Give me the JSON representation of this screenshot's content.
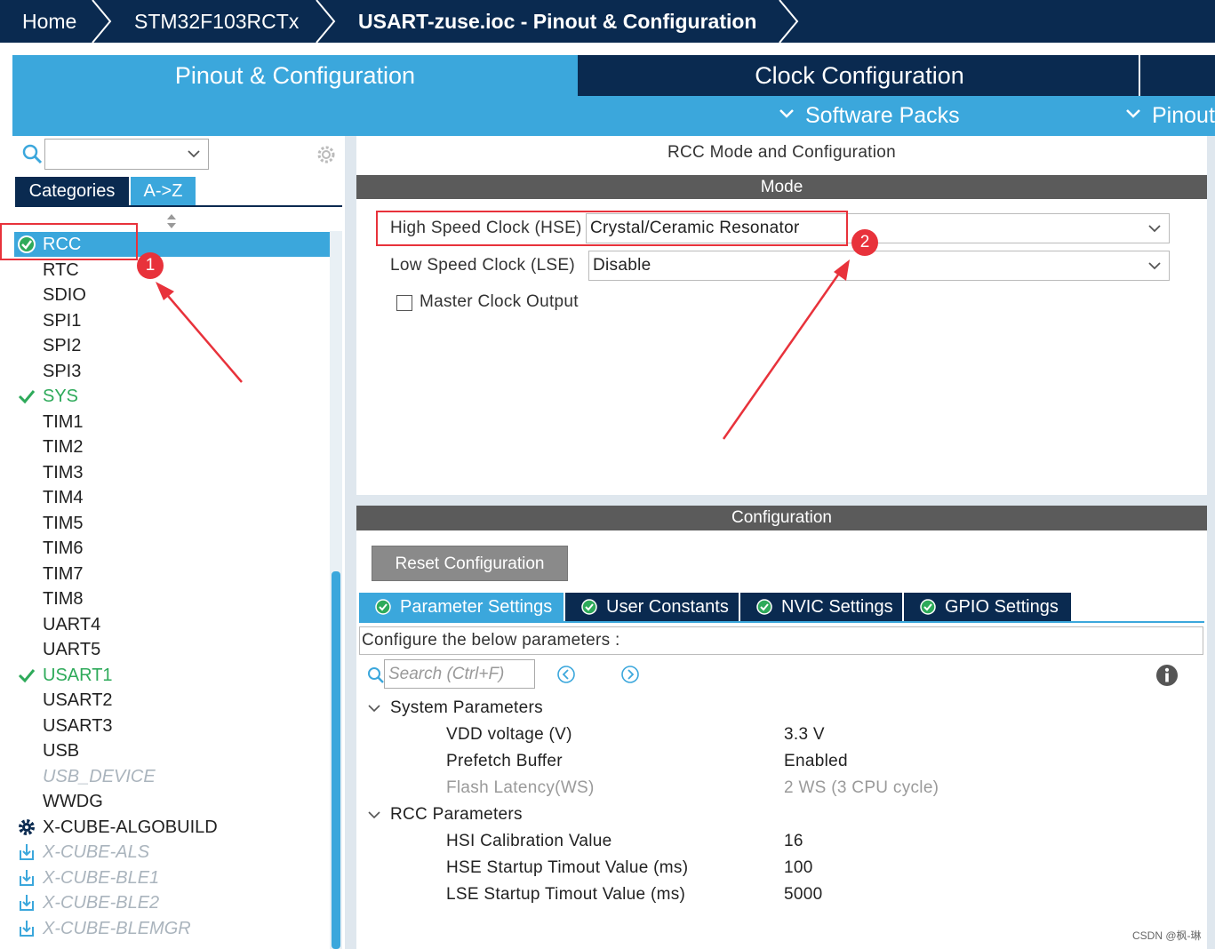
{
  "breadcrumb": {
    "home": "Home",
    "device": "STM32F103RCTx",
    "project": "USART-zuse.ioc - Pinout & Configuration"
  },
  "tabs": {
    "pinout": "Pinout & Configuration",
    "clock": "Clock Configuration"
  },
  "subtabs": {
    "software_packs": "Software Packs",
    "pinout": "Pinout"
  },
  "sidebar": {
    "tab_categories": "Categories",
    "tab_az": "A->Z",
    "items": [
      {
        "label": "RCC"
      },
      {
        "label": "RTC"
      },
      {
        "label": "SDIO"
      },
      {
        "label": "SPI1"
      },
      {
        "label": "SPI2"
      },
      {
        "label": "SPI3"
      },
      {
        "label": "SYS"
      },
      {
        "label": "TIM1"
      },
      {
        "label": "TIM2"
      },
      {
        "label": "TIM3"
      },
      {
        "label": "TIM4"
      },
      {
        "label": "TIM5"
      },
      {
        "label": "TIM6"
      },
      {
        "label": "TIM7"
      },
      {
        "label": "TIM8"
      },
      {
        "label": "UART4"
      },
      {
        "label": "UART5"
      },
      {
        "label": "USART1"
      },
      {
        "label": "USART2"
      },
      {
        "label": "USART3"
      },
      {
        "label": "USB"
      },
      {
        "label": "USB_DEVICE"
      },
      {
        "label": "WWDG"
      },
      {
        "label": "X-CUBE-ALGOBUILD"
      },
      {
        "label": "X-CUBE-ALS"
      },
      {
        "label": "X-CUBE-BLE1"
      },
      {
        "label": "X-CUBE-BLE2"
      },
      {
        "label": "X-CUBE-BLEMGR"
      }
    ]
  },
  "rcc": {
    "title": "RCC Mode and Configuration",
    "mode_header": "Mode",
    "hse_label": "High Speed Clock (HSE)",
    "hse_value": "Crystal/Ceramic Resonator",
    "lse_label": "Low Speed Clock (LSE)",
    "lse_value": "Disable",
    "mco_label": "Master Clock Output",
    "config_header": "Configuration",
    "reset_button": "Reset Configuration"
  },
  "param_tabs": {
    "parameter_settings": "Parameter Settings",
    "user_constants": "User Constants",
    "nvic_settings": "NVIC Settings",
    "gpio_settings": "GPIO Settings"
  },
  "params": {
    "configure_text": "Configure the below parameters :",
    "search_placeholder": "Search (Ctrl+F)",
    "system_group": "System Parameters",
    "vdd_name": "VDD voltage (V)",
    "vdd_value": "3.3 V",
    "prefetch_name": "Prefetch Buffer",
    "prefetch_value": "Enabled",
    "flash_name": "Flash Latency(WS)",
    "flash_value": "2 WS (3 CPU cycle)",
    "rcc_group": "RCC Parameters",
    "hsi_name": "HSI Calibration Value",
    "hsi_value": "16",
    "hse_startup_name": "HSE Startup Timout Value (ms)",
    "hse_startup_value": "100",
    "lse_startup_name": "LSE Startup Timout Value (ms)",
    "lse_startup_value": "5000"
  },
  "annotations": {
    "marker_1": "1",
    "marker_2": "2",
    "color": "#e8323b"
  },
  "watermark": "CSDN @枫-琳",
  "colors": {
    "navy": "#0a2a50",
    "accent": "#3ba7dc",
    "enabled_green": "#2eaa5a"
  }
}
